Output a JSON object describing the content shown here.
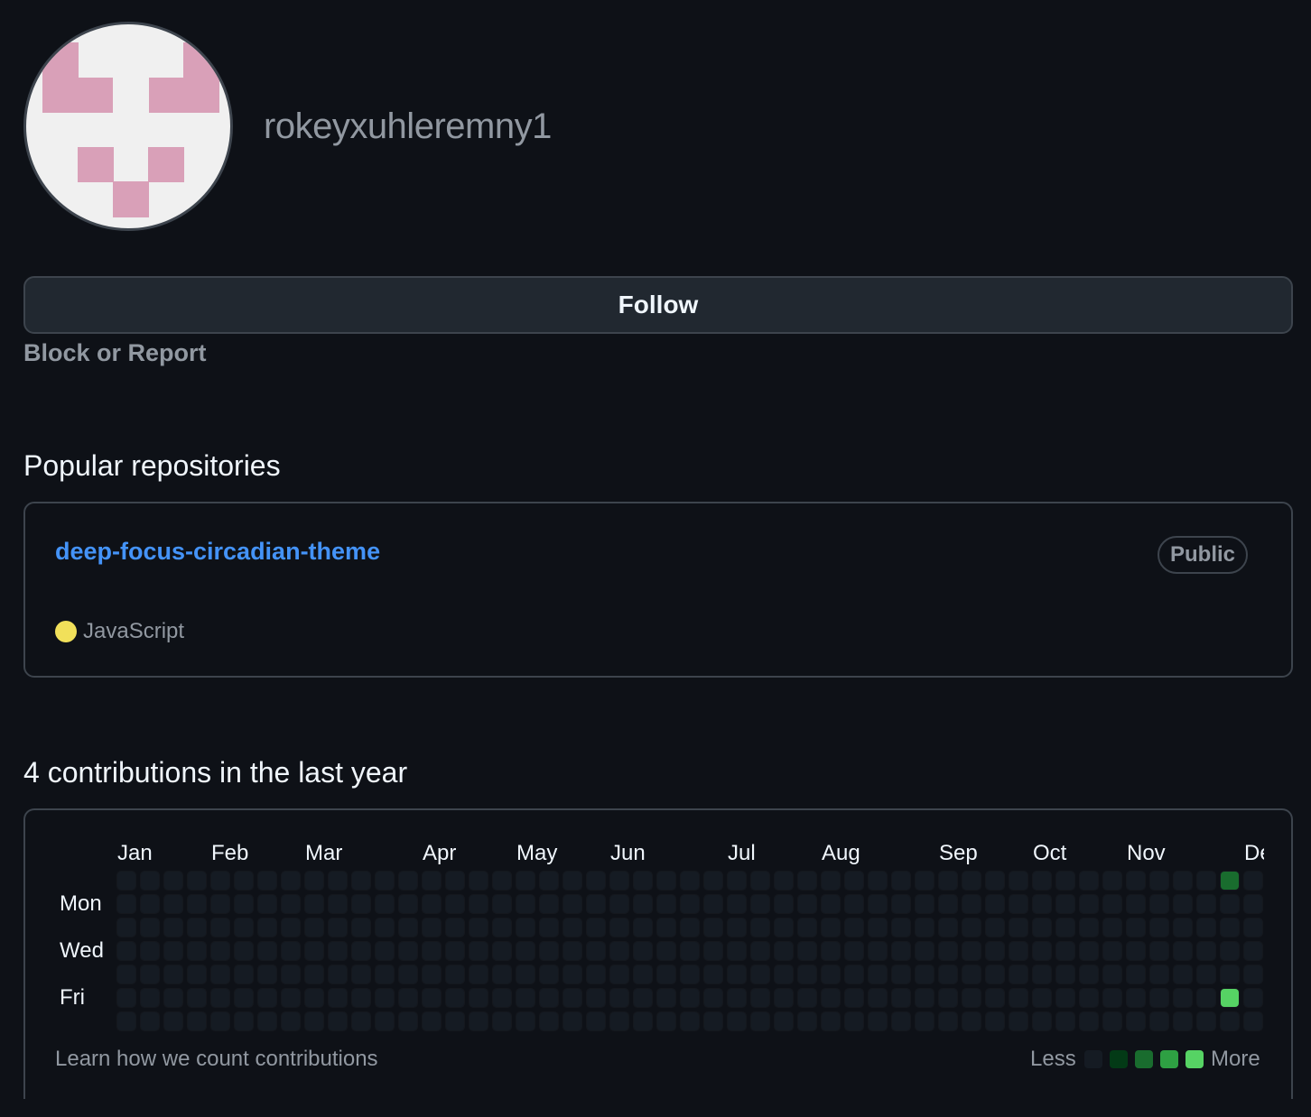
{
  "profile": {
    "username": "rokeyxuhleremny1",
    "avatar_icon": "identicon",
    "avatar_colors": {
      "background": "#f0f0f0",
      "pattern": "#d9a0b8"
    }
  },
  "actions": {
    "follow_label": "Follow",
    "block_report_label": "Block or Report"
  },
  "popular": {
    "title": "Popular repositories",
    "repos": [
      {
        "name": "deep-focus-circadian-theme",
        "visibility": "Public",
        "language": "JavaScript",
        "language_color": "#f1e05a"
      }
    ]
  },
  "contributions": {
    "title": "4 contributions in the last year",
    "months": [
      "Jan",
      "Feb",
      "Mar",
      "Apr",
      "May",
      "Jun",
      "Jul",
      "Aug",
      "Sep",
      "Oct",
      "Nov",
      "Dec"
    ],
    "days": [
      "Mon",
      "Wed",
      "Fri"
    ],
    "learn_label": "Learn how we count contributions",
    "legend_less": "Less",
    "legend_more": "More",
    "level_colors": [
      "#151b23",
      "#033a16",
      "#196c2e",
      "#2ea043",
      "#56d364"
    ],
    "active_cells": [
      {
        "week": 47,
        "weekday": 0,
        "level": 2
      },
      {
        "week": 47,
        "weekday": 5,
        "level": 4
      }
    ]
  }
}
